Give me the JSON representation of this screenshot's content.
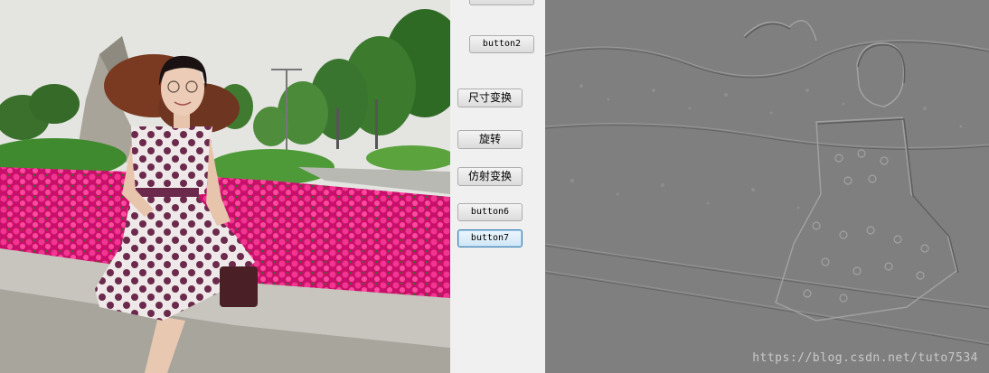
{
  "buttons": {
    "button1": "",
    "button2": "button2",
    "resize": "尺寸变换",
    "rotate": "旋转",
    "affine": "仿射变换",
    "button6": "button6",
    "button7": "button7"
  },
  "watermark": "https://blog.csdn.net/tuto7534",
  "colors": {
    "window_bg": "#f0f0f0",
    "emboss_gray": "#7f7f7f",
    "flower_magenta": "#e0187a",
    "focus_border": "#3c7fb1"
  }
}
